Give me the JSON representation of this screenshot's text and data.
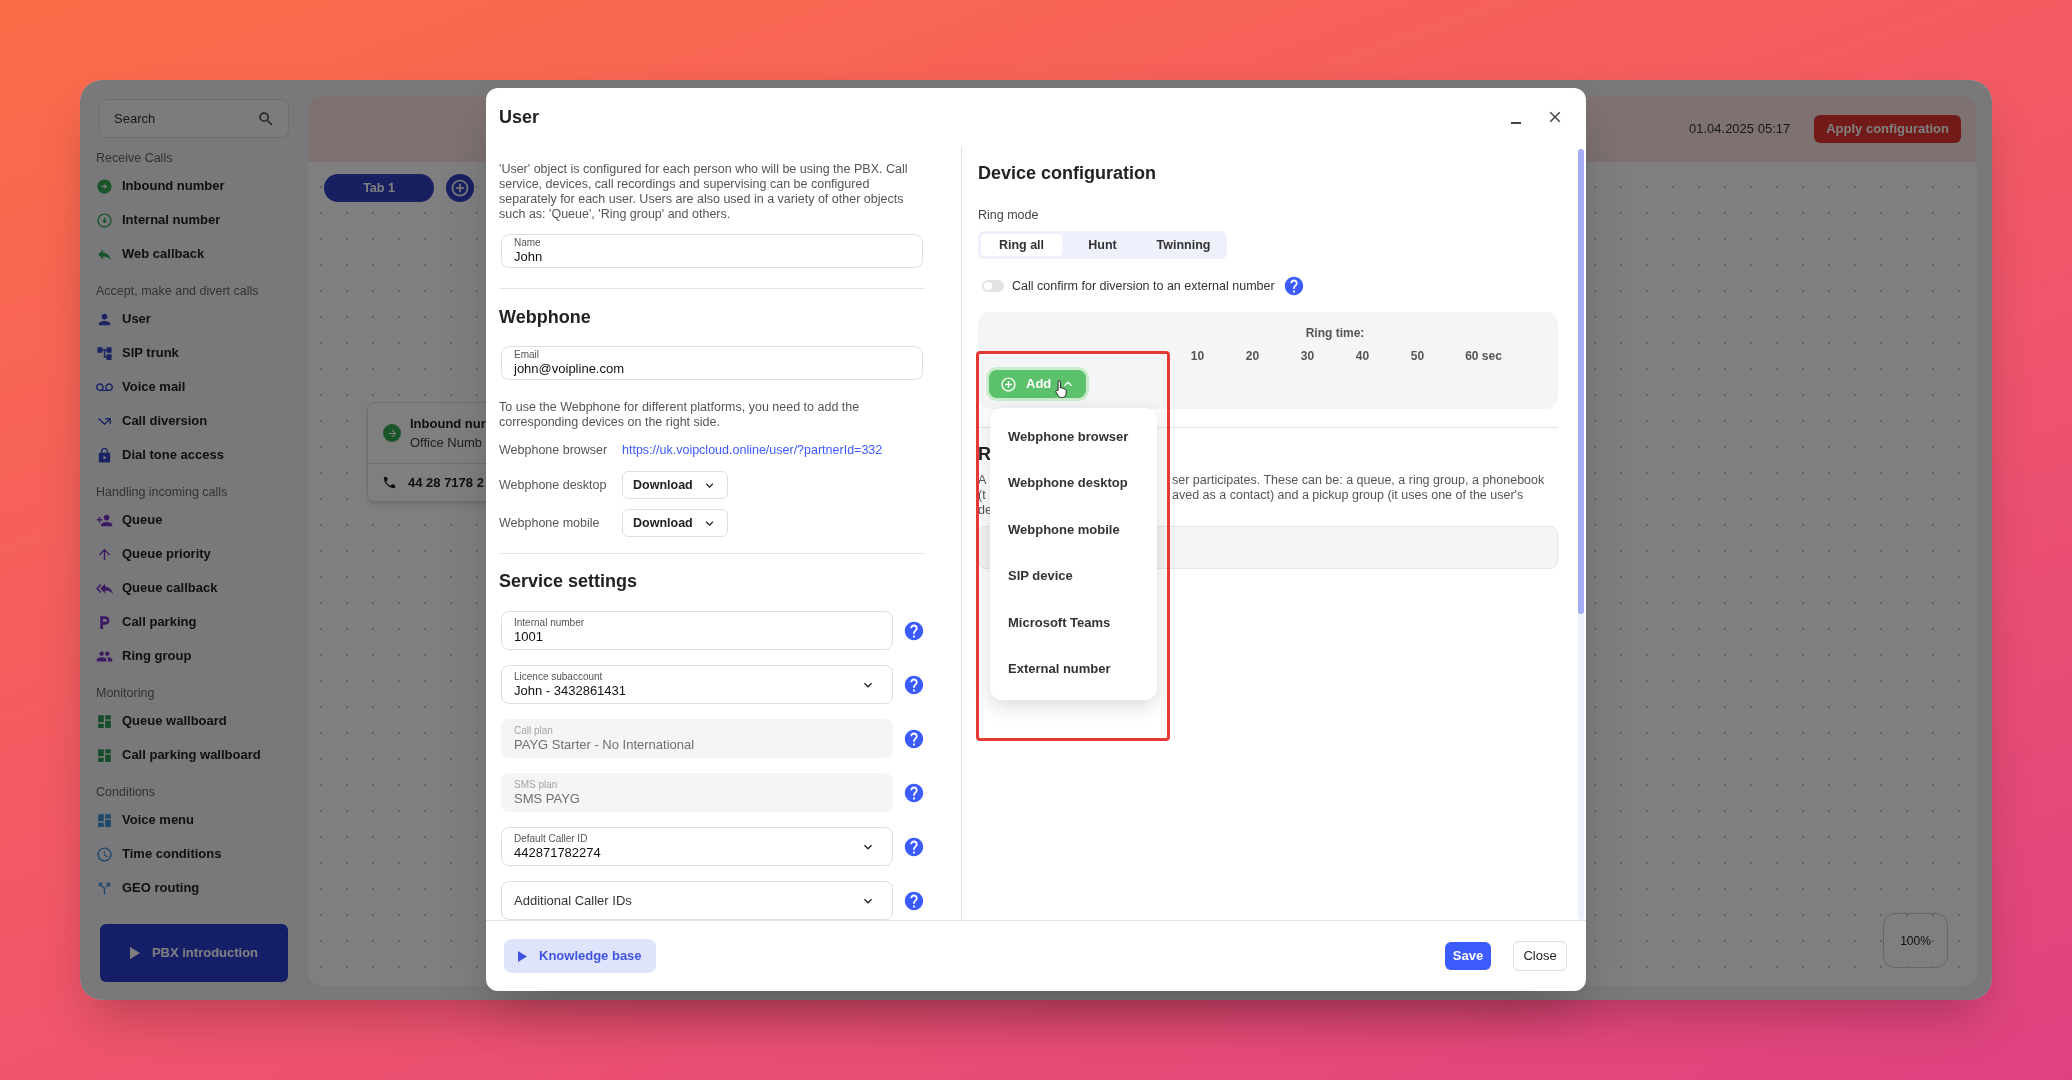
{
  "sidebar": {
    "search": {
      "placeholder": "Search"
    },
    "sections": [
      {
        "title": "Receive Calls",
        "items": [
          "Inbound number",
          "Internal number",
          "Web callback"
        ]
      },
      {
        "title": "Accept, make and divert calls",
        "items": [
          "User",
          "SIP trunk",
          "Voice mail",
          "Call diversion",
          "Dial tone access"
        ]
      },
      {
        "title": "Handling incoming calls",
        "items": [
          "Queue",
          "Queue priority",
          "Queue callback",
          "Call parking",
          "Ring group"
        ]
      },
      {
        "title": "Monitoring",
        "items": [
          "Queue wallboard",
          "Call parking wallboard"
        ]
      },
      {
        "title": "Conditions",
        "items": [
          "Voice menu",
          "Time conditions",
          "GEO routing"
        ]
      }
    ],
    "intro_button": "PBX introduction"
  },
  "canvas": {
    "date": "01.04.2025 05:17",
    "apply_button": "Apply configuration",
    "tabs": [
      {
        "label": "Tab 1",
        "selected": true
      }
    ],
    "node": {
      "title": "Inbound nur",
      "subtitle": "Office Numb",
      "phone": "44 28 7178 2"
    },
    "zoom": "100%"
  },
  "dialog": {
    "title": "User",
    "intro": "'User' object is configured for each person who will be using the PBX. Call service, devices, call recordings and supervising can be configured separately for each user. Users are also used in a variety of other objects such as: 'Queue', 'Ring group' and others.",
    "name": {
      "label": "Name",
      "value": "John"
    },
    "webphone": {
      "title": "Webphone",
      "email": {
        "label": "Email",
        "value": "john@voipline.com"
      },
      "note": "To use the Webphone for different platforms, you need to add the corresponding devices on the right side.",
      "rows": [
        {
          "kind": "link",
          "label": "Webphone browser",
          "value": "https://uk.voipcloud.online/user/?partnerId=332"
        },
        {
          "kind": "select",
          "label": "Webphone desktop",
          "value": "Download"
        },
        {
          "kind": "select",
          "label": "Webphone mobile",
          "value": "Download"
        }
      ]
    },
    "service": {
      "title": "Service settings",
      "fields": [
        {
          "kind": "text",
          "label": "Internal number",
          "value": "1001",
          "disabled": false
        },
        {
          "kind": "select",
          "label": "Licence subaccount",
          "value": "John - 3432861431",
          "disabled": false
        },
        {
          "kind": "text",
          "label": "Call plan",
          "value": "PAYG Starter - No International",
          "disabled": true
        },
        {
          "kind": "text",
          "label": "SMS plan",
          "value": "SMS PAYG",
          "disabled": true
        },
        {
          "kind": "select",
          "label": "Default Caller ID",
          "value": "442871782274",
          "disabled": false
        },
        {
          "kind": "select",
          "placeholder": "Additional Caller IDs",
          "disabled": false
        }
      ]
    },
    "device": {
      "title": "Device configuration",
      "ring_mode_label": "Ring mode",
      "ring_modes": [
        {
          "label": "Ring all",
          "selected": true
        },
        {
          "label": "Hunt",
          "selected": false
        },
        {
          "label": "Twinning",
          "selected": false
        }
      ],
      "call_confirm": {
        "label": "Call confirm for diversion to an external number",
        "on": false
      },
      "ring_time": {
        "label": "Ring time:",
        "ticks": [
          "10",
          "20",
          "30",
          "40",
          "50",
          "60 sec"
        ]
      },
      "add_button": {
        "label": "Add",
        "expanded": true
      },
      "add_menu": [
        "Webphone browser",
        "Webphone desktop",
        "Webphone mobile",
        "SIP device",
        "Microsoft Teams",
        "External number"
      ],
      "section_title": "R",
      "section_lines": [
        {
          "left": "A",
          "right": "ser participates. These can be: a queue, a ring group, a phonebook"
        },
        {
          "left": "(t",
          "right": "aved as a contact) and a pickup group (it uses one of the user's"
        },
        {
          "left": "de"
        }
      ]
    },
    "footer": {
      "knowledge_base": "Knowledge base",
      "save": "Save",
      "close": "Close"
    }
  }
}
